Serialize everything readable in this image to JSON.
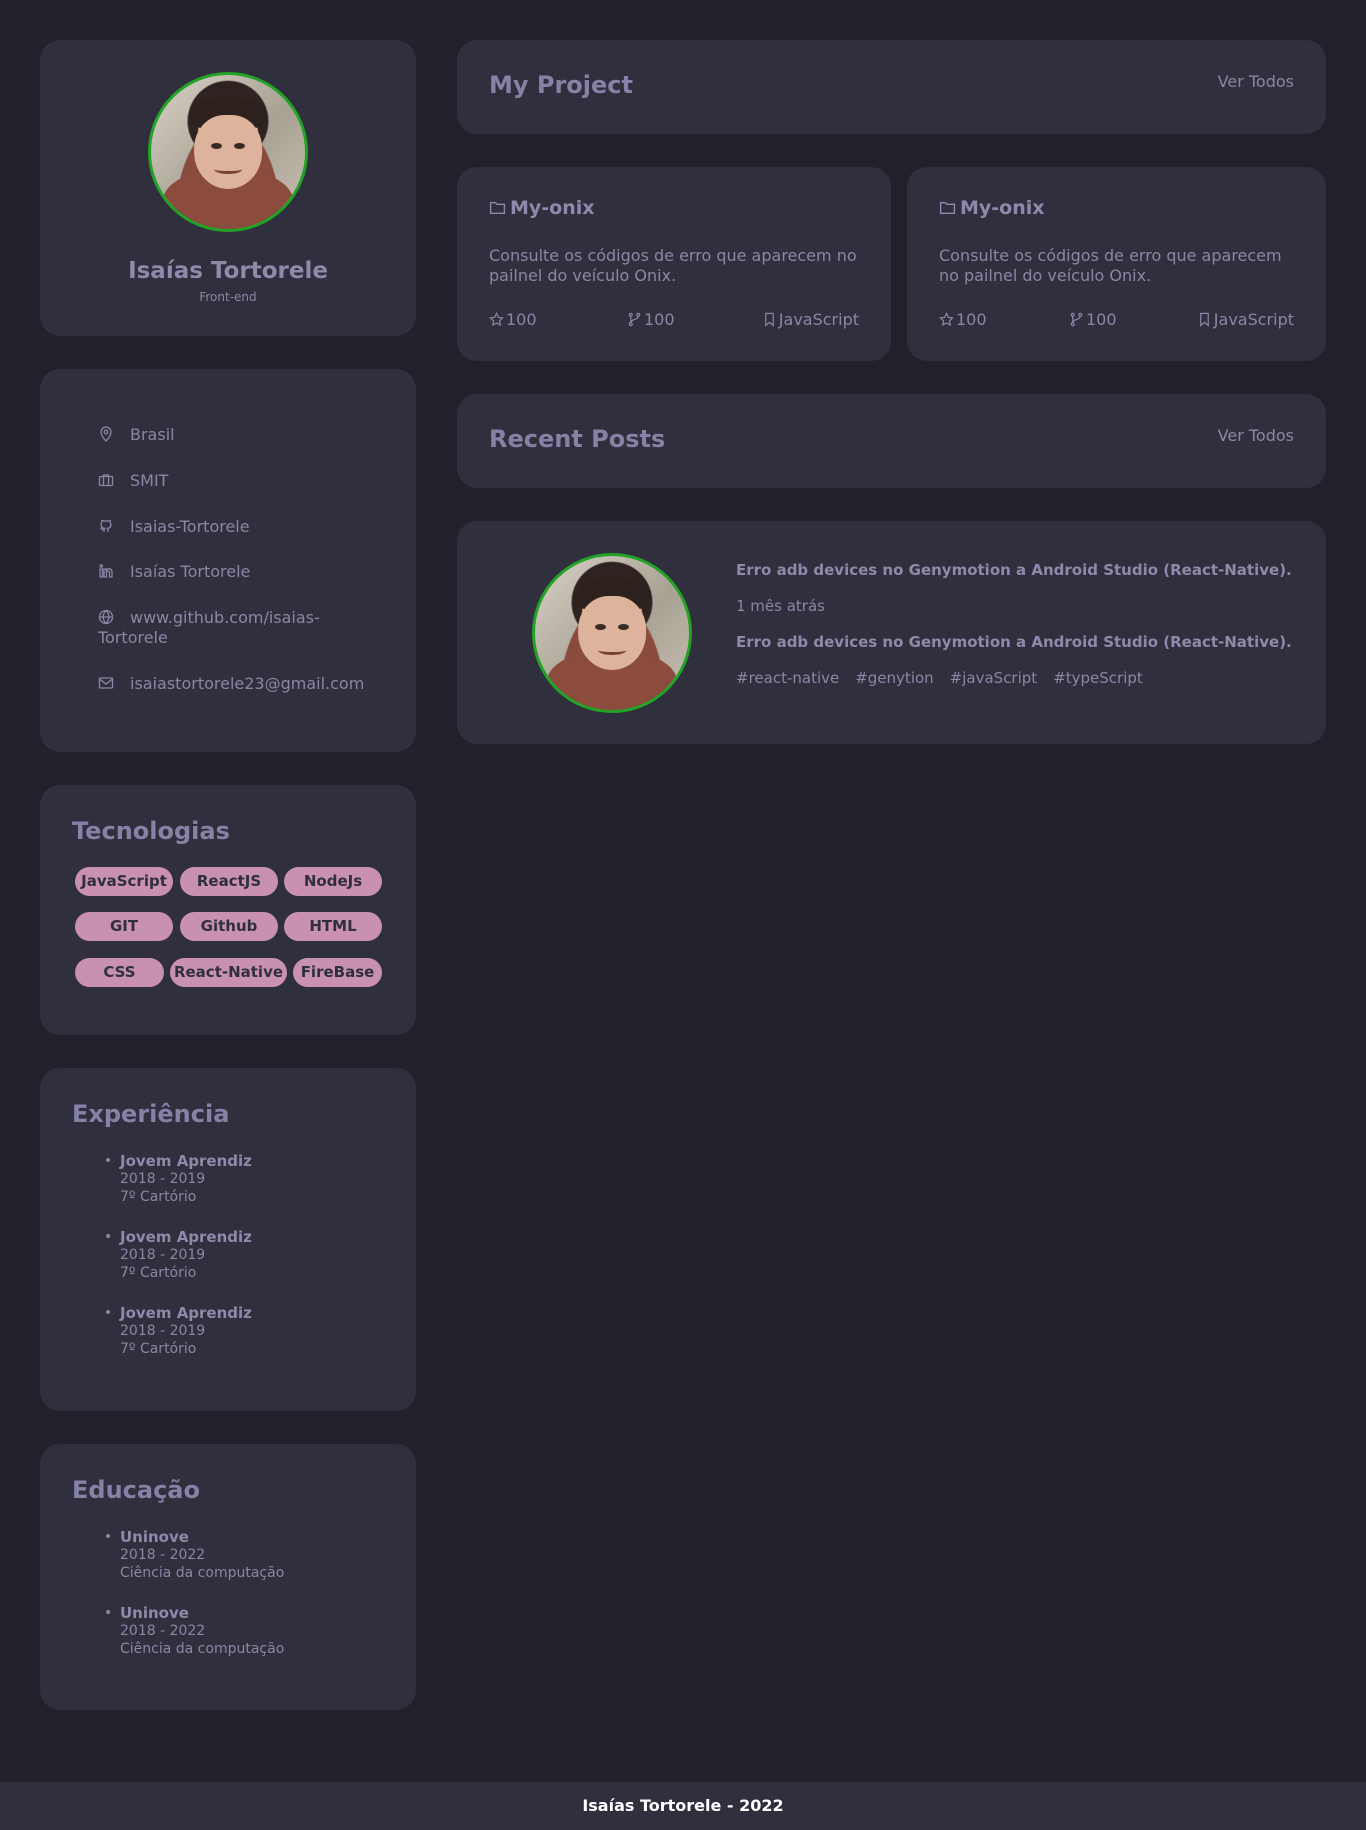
{
  "profile": {
    "name": "Isaías Tortorele",
    "role": "Front-end"
  },
  "info": {
    "location": "Brasil",
    "company": "SMIT",
    "github_user": "Isaias-Tortorele",
    "linkedin": "Isaías Tortorele",
    "website_line1": "www.github.com/isaias-",
    "website_line2": "Tortorele",
    "email": "isaiastortorele23@gmail.com"
  },
  "technologies": {
    "title": "Tecnologias",
    "tags": [
      "JavaScript",
      "ReactJS",
      "NodeJs",
      "GIT",
      "Github",
      "HTML",
      "CSS",
      "React-Native",
      "FireBase"
    ]
  },
  "experience": {
    "title": "Experiência",
    "items": [
      {
        "role": "Jovem Aprendiz",
        "period": "2018 - 2019",
        "place": "7º Cartório"
      },
      {
        "role": "Jovem Aprendiz",
        "period": "2018 - 2019",
        "place": "7º Cartório"
      },
      {
        "role": "Jovem Aprendiz",
        "period": "2018 - 2019",
        "place": "7º Cartório"
      }
    ]
  },
  "education": {
    "title": "Educação",
    "items": [
      {
        "school": "Uninove",
        "period": "2018 - 2022",
        "course": "Ciência da computação"
      },
      {
        "school": "Uninove",
        "period": "2018 - 2022",
        "course": "Ciência da computação"
      }
    ]
  },
  "projects_header": {
    "title": "My Project",
    "link": "Ver Todos"
  },
  "projects": [
    {
      "name": "My-onix",
      "description": "Consulte os códigos de erro que aparecem no pailnel do veículo Onix.",
      "stars": "100",
      "forks": "100",
      "language": "JavaScript"
    },
    {
      "name": "My-onix",
      "description": "Consulte os códigos de erro que aparecem no pailnel do veículo Onix.",
      "stars": "100",
      "forks": "100",
      "language": "JavaScript"
    }
  ],
  "posts_header": {
    "title": "Recent Posts",
    "link": "Ver Todos"
  },
  "post": {
    "title": "Erro adb devices no Genymotion a Android Studio (React-Native).",
    "time": "1 mês atrás",
    "subtitle": "Erro adb devices no Genymotion a Android Studio (React-Native).",
    "hashtags": [
      "#react-native",
      "#genytion",
      "#javaScript",
      "#typeScript"
    ]
  },
  "footer": {
    "text": "Isaías Tortorele - 2022"
  },
  "colors": {
    "background": "#22212b",
    "card": "#302f3d",
    "accent_tag": "#c991b0",
    "avatar_border": "#22a325"
  }
}
